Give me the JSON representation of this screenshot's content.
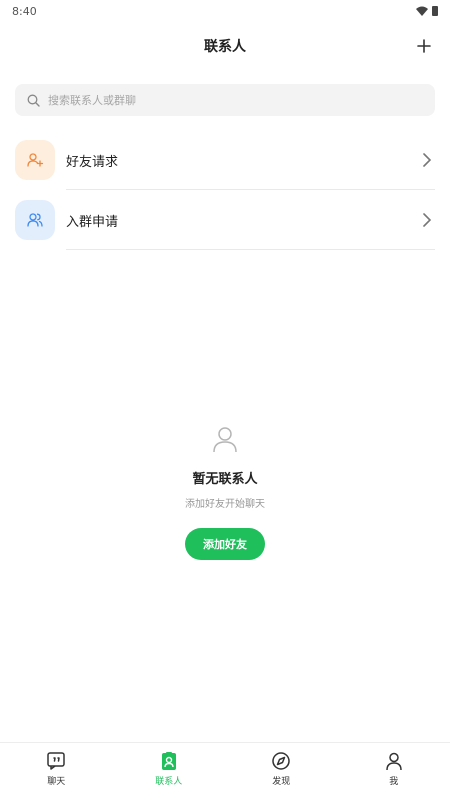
{
  "status_bar": {
    "time": "8:40"
  },
  "header": {
    "title": "联系人"
  },
  "search": {
    "placeholder": "搜索联系人或群聊"
  },
  "entries": [
    {
      "label": "好友请求",
      "icon": "user-add-icon",
      "color": "#f0883e",
      "bg": "#fdeedd"
    },
    {
      "label": "入群申请",
      "icon": "group-icon",
      "color": "#3d8bf0",
      "bg": "#e3eefd"
    }
  ],
  "empty_state": {
    "title": "暂无联系人",
    "subtitle": "添加好友开始聊天",
    "button_label": "添加好友"
  },
  "tabbar": {
    "active_color": "#1fbf5c",
    "tabs": [
      {
        "label": "聊天",
        "icon": "chat-icon",
        "active": false
      },
      {
        "label": "联系人",
        "icon": "contacts-icon",
        "active": true
      },
      {
        "label": "发现",
        "icon": "discover-icon",
        "active": false
      },
      {
        "label": "我",
        "icon": "profile-icon",
        "active": false
      }
    ]
  }
}
